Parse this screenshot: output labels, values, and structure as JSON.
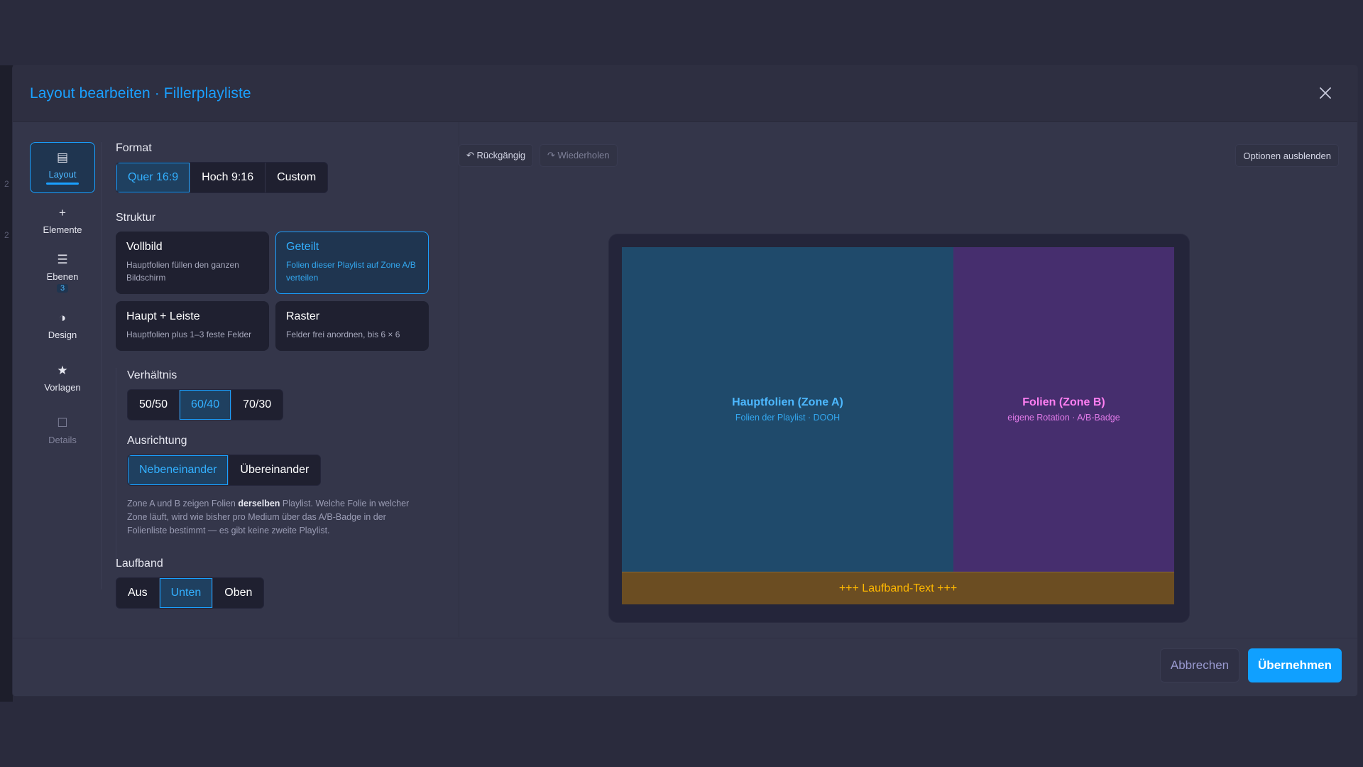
{
  "modal": {
    "title": "Layout bearbeiten · Fillerplayliste"
  },
  "rail": {
    "items": [
      {
        "label": "Layout",
        "icon": "▤"
      },
      {
        "label": "Elemente",
        "icon": "+"
      },
      {
        "label": "Ebenen",
        "icon": "☰",
        "badge": "3"
      },
      {
        "label": "Design",
        "icon": "◑"
      },
      {
        "label": "Vorlagen",
        "icon": "★"
      },
      {
        "label": "Details",
        "icon": "☐"
      }
    ]
  },
  "format": {
    "label": "Format",
    "options": [
      "Quer 16:9",
      "Hoch 9:16",
      "Custom"
    ],
    "selected": "Quer 16:9"
  },
  "structure": {
    "label": "Struktur",
    "cards": [
      {
        "title": "Vollbild",
        "desc": "Hauptfolien füllen den ganzen Bildschirm"
      },
      {
        "title": "Geteilt",
        "desc": "Folien dieser Playlist auf Zone A/B verteilen"
      },
      {
        "title": "Haupt + Leiste",
        "desc": "Hauptfolien plus 1–3 feste Felder"
      },
      {
        "title": "Raster",
        "desc": "Felder frei anordnen, bis 6 × 6"
      }
    ],
    "selected": "Geteilt"
  },
  "ratio": {
    "label": "Verhältnis",
    "options": [
      "50/50",
      "60/40",
      "70/30"
    ],
    "selected": "60/40"
  },
  "orientation": {
    "label": "Ausrichtung",
    "options": [
      "Nebeneinander",
      "Übereinander"
    ],
    "selected": "Nebeneinander"
  },
  "hint": {
    "part1": "Zone A und B zeigen Folien ",
    "bold": "derselben",
    "part2": " Playlist. Welche Folie in welcher Zone läuft, wird wie bisher pro Medium über das A/B-Badge in der Folienliste bestimmt — es gibt keine zweite Playlist."
  },
  "ticker_setting": {
    "label": "Laufband",
    "options": [
      "Aus",
      "Unten",
      "Oben"
    ],
    "selected": "Unten"
  },
  "toolbar": {
    "undo": "↶ Rückgängig",
    "redo": "↷ Wiederholen",
    "hide_options": "Optionen ausblenden"
  },
  "preview": {
    "zone_a": {
      "title": "Hauptfolien (Zone A)",
      "sub": "Folien der Playlist · DOOH"
    },
    "zone_b": {
      "title": "Folien (Zone B)",
      "sub": "eigene Rotation · A/B-Badge"
    },
    "ticker": "+++ Laufband-Text +++"
  },
  "footer": {
    "cancel": "Abbrechen",
    "apply": "Übernehmen"
  },
  "colors": {
    "accent": "#1aa0ff",
    "zone_a": "#1f4a6b",
    "zone_b": "#462e6e",
    "ticker": "#6b4d22"
  }
}
